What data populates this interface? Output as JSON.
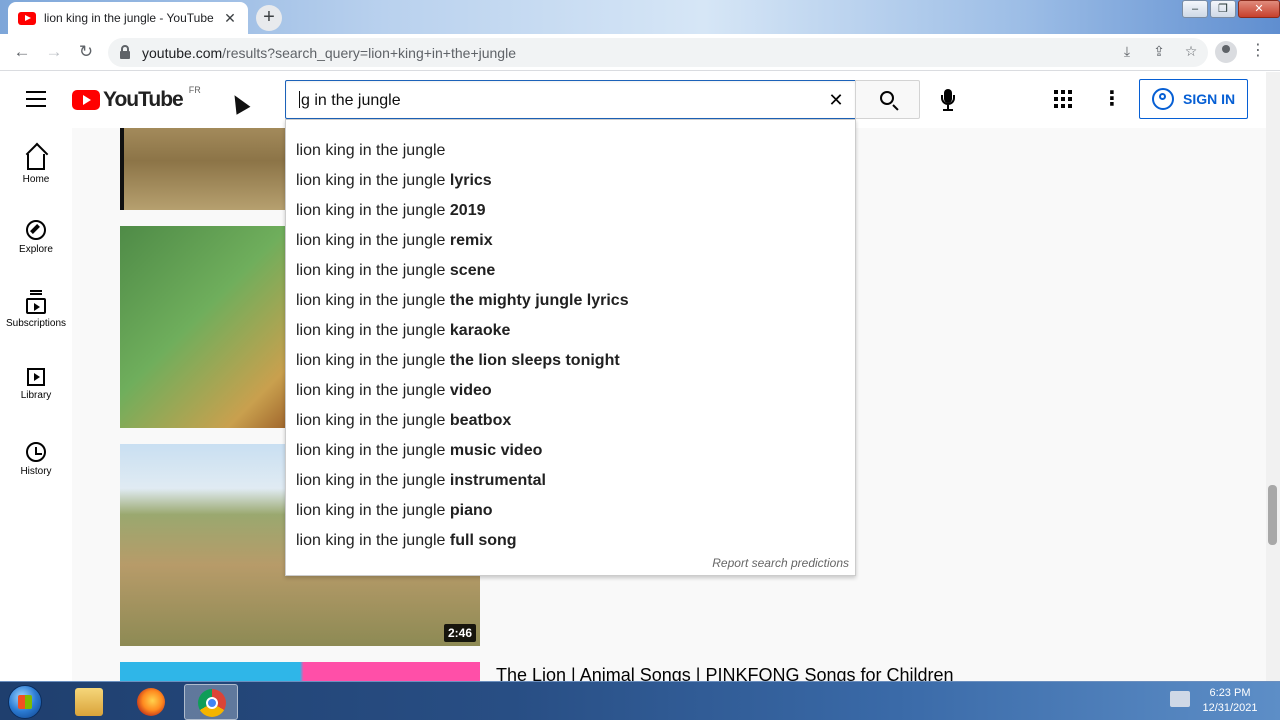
{
  "browser": {
    "tab_title": "lion king in the jungle - YouTube",
    "tab_close": "✕",
    "new_tab": "+",
    "window_controls": {
      "minimize": "–",
      "maximize": "❐",
      "close": "✕"
    },
    "nav": {
      "back": "←",
      "forward": "→",
      "reload": "↻"
    },
    "url_host": "youtube.com",
    "url_path": "/results?search_query=lion+king+in+the+jungle",
    "omnibox_icons": {
      "install": "⤓",
      "share": "⇪",
      "bookmark": "☆"
    },
    "menu": "⋮"
  },
  "youtube": {
    "logo_word": "YouTube",
    "country_code": "FR",
    "search": {
      "value": "g in the jungle",
      "clear": "✕"
    },
    "more": "⋮",
    "sign_in_label": "SIGN IN",
    "accent_color": "#065fd4",
    "brand_color": "#ff0000"
  },
  "guide": {
    "items": [
      {
        "label": "Home",
        "icon": "home-icon"
      },
      {
        "label": "Explore",
        "icon": "compass-icon"
      },
      {
        "label": "Subscriptions",
        "icon": "subscriptions-icon"
      },
      {
        "label": "Library",
        "icon": "library-icon"
      },
      {
        "label": "History",
        "icon": "history-icon"
      }
    ]
  },
  "suggestions": {
    "prefix": "lion king in the jungle",
    "items": [
      "",
      "lyrics",
      "2019",
      "remix",
      "scene",
      "the mighty jungle lyrics",
      "karaoke",
      "the lion sleeps tonight",
      "video",
      "beatbox",
      "music video",
      "instrumental",
      "piano",
      "full song"
    ],
    "report_label": "Report search predictions"
  },
  "results": {
    "video3_duration": "2:46",
    "video4_title": "The Lion | Animal Songs | PINKFONG Songs for Children"
  },
  "taskbar": {
    "time": "6:23 PM",
    "date": "12/31/2021"
  }
}
